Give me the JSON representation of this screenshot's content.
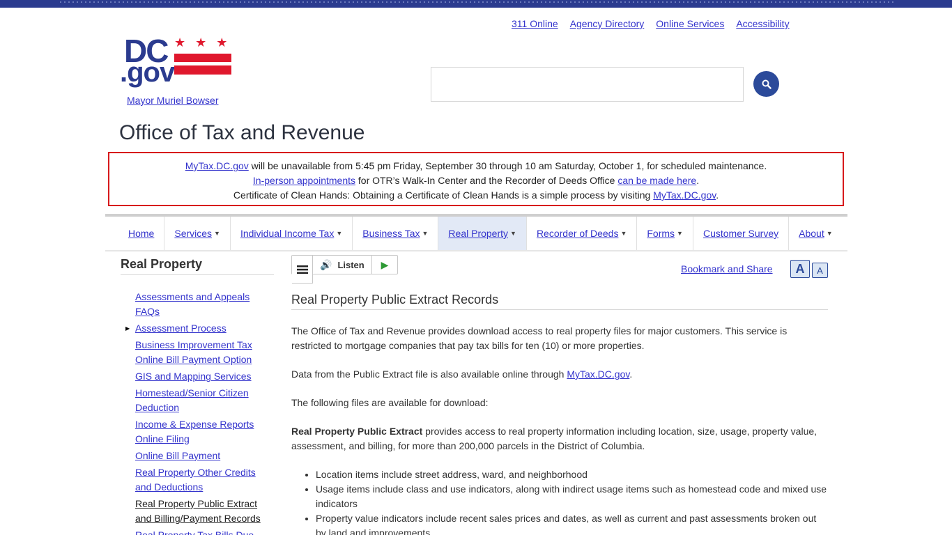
{
  "utility_links": [
    "311 Online",
    "Agency Directory",
    "Online Services",
    "Accessibility"
  ],
  "logo": {
    "dc": "DC",
    "gov": ".gov",
    "stars": "★★★"
  },
  "mayor_link": "Mayor Muriel Bowser",
  "search": {
    "placeholder": ""
  },
  "site_title": "Office of Tax and Revenue",
  "alert": {
    "line1_link": "MyTax.DC.gov",
    "line1_text": " will be unavailable from 5:45 pm Friday, September 30 through 10 am Saturday, October 1, for scheduled maintenance.",
    "line2_link1": "In-person appointments",
    "line2_text": " for OTR’s Walk-In Center and the Recorder of Deeds Office ",
    "line2_link2": "can be made here",
    "line2_end": ".",
    "line3_text": "Certificate of Clean Hands: Obtaining a Certificate of Clean Hands is a simple process by visiting ",
    "line3_link": "MyTax.DC.gov",
    "line3_end": "."
  },
  "nav": [
    {
      "label": "Home",
      "caret": false,
      "active": false
    },
    {
      "label": "Services",
      "caret": true,
      "active": false
    },
    {
      "label": "Individual Income Tax",
      "caret": true,
      "active": false
    },
    {
      "label": "Business Tax",
      "caret": true,
      "active": false
    },
    {
      "label": "Real Property",
      "caret": true,
      "active": true
    },
    {
      "label": "Recorder of Deeds",
      "caret": true,
      "active": false
    },
    {
      "label": "Forms",
      "caret": true,
      "active": false
    },
    {
      "label": "Customer Survey",
      "caret": false,
      "active": false
    },
    {
      "label": "About",
      "caret": true,
      "active": false
    }
  ],
  "sidebar": {
    "title": "Real Property",
    "items": [
      {
        "label": "Assessments and Appeals FAQs"
      },
      {
        "label": "Assessment Process",
        "arrow": true
      },
      {
        "label": "Business Improvement Tax Online Bill Payment Option"
      },
      {
        "label": "GIS and Mapping Services"
      },
      {
        "label": "Homestead/Senior Citizen Deduction"
      },
      {
        "label": "Income & Expense Reports Online Filing"
      },
      {
        "label": "Online Bill Payment"
      },
      {
        "label": "Real Property Other Credits and Deductions"
      },
      {
        "label": "Real Property Public Extract and Billing/Payment Records",
        "current": true
      },
      {
        "label": "Real Property Tax Bills Due"
      }
    ]
  },
  "toolbar": {
    "listen_label": "Listen"
  },
  "bookmark_label": "Bookmark and Share",
  "font_buttons": {
    "up": "A",
    "down": "A"
  },
  "page_title": "Real Property Public Extract Records",
  "content": {
    "p1": "The Office of Tax and Revenue provides download access to real property files for major customers. This service is restricted to mortgage companies that pay tax bills for ten (10) or more properties.",
    "p2_text": "Data from the Public Extract file is also available online through ",
    "p2_link": "MyTax.DC.gov",
    "p2_end": ".",
    "p3": "The following files are available for download:",
    "p4_bold": "Real Property Public Extract",
    "p4_text": " provides access to real property information including location, size, usage, property value, assessment, and billing, for more than 200,000 parcels in the District of Columbia.",
    "bullets": [
      "Location items include street address, ward, and neighborhood",
      "Usage items include class and use indicators, along with indirect usage items such as homestead code and mixed use indicators",
      "Property value indicators include recent sales prices and dates, as well as current and past assessments broken out by land and improvements"
    ]
  }
}
